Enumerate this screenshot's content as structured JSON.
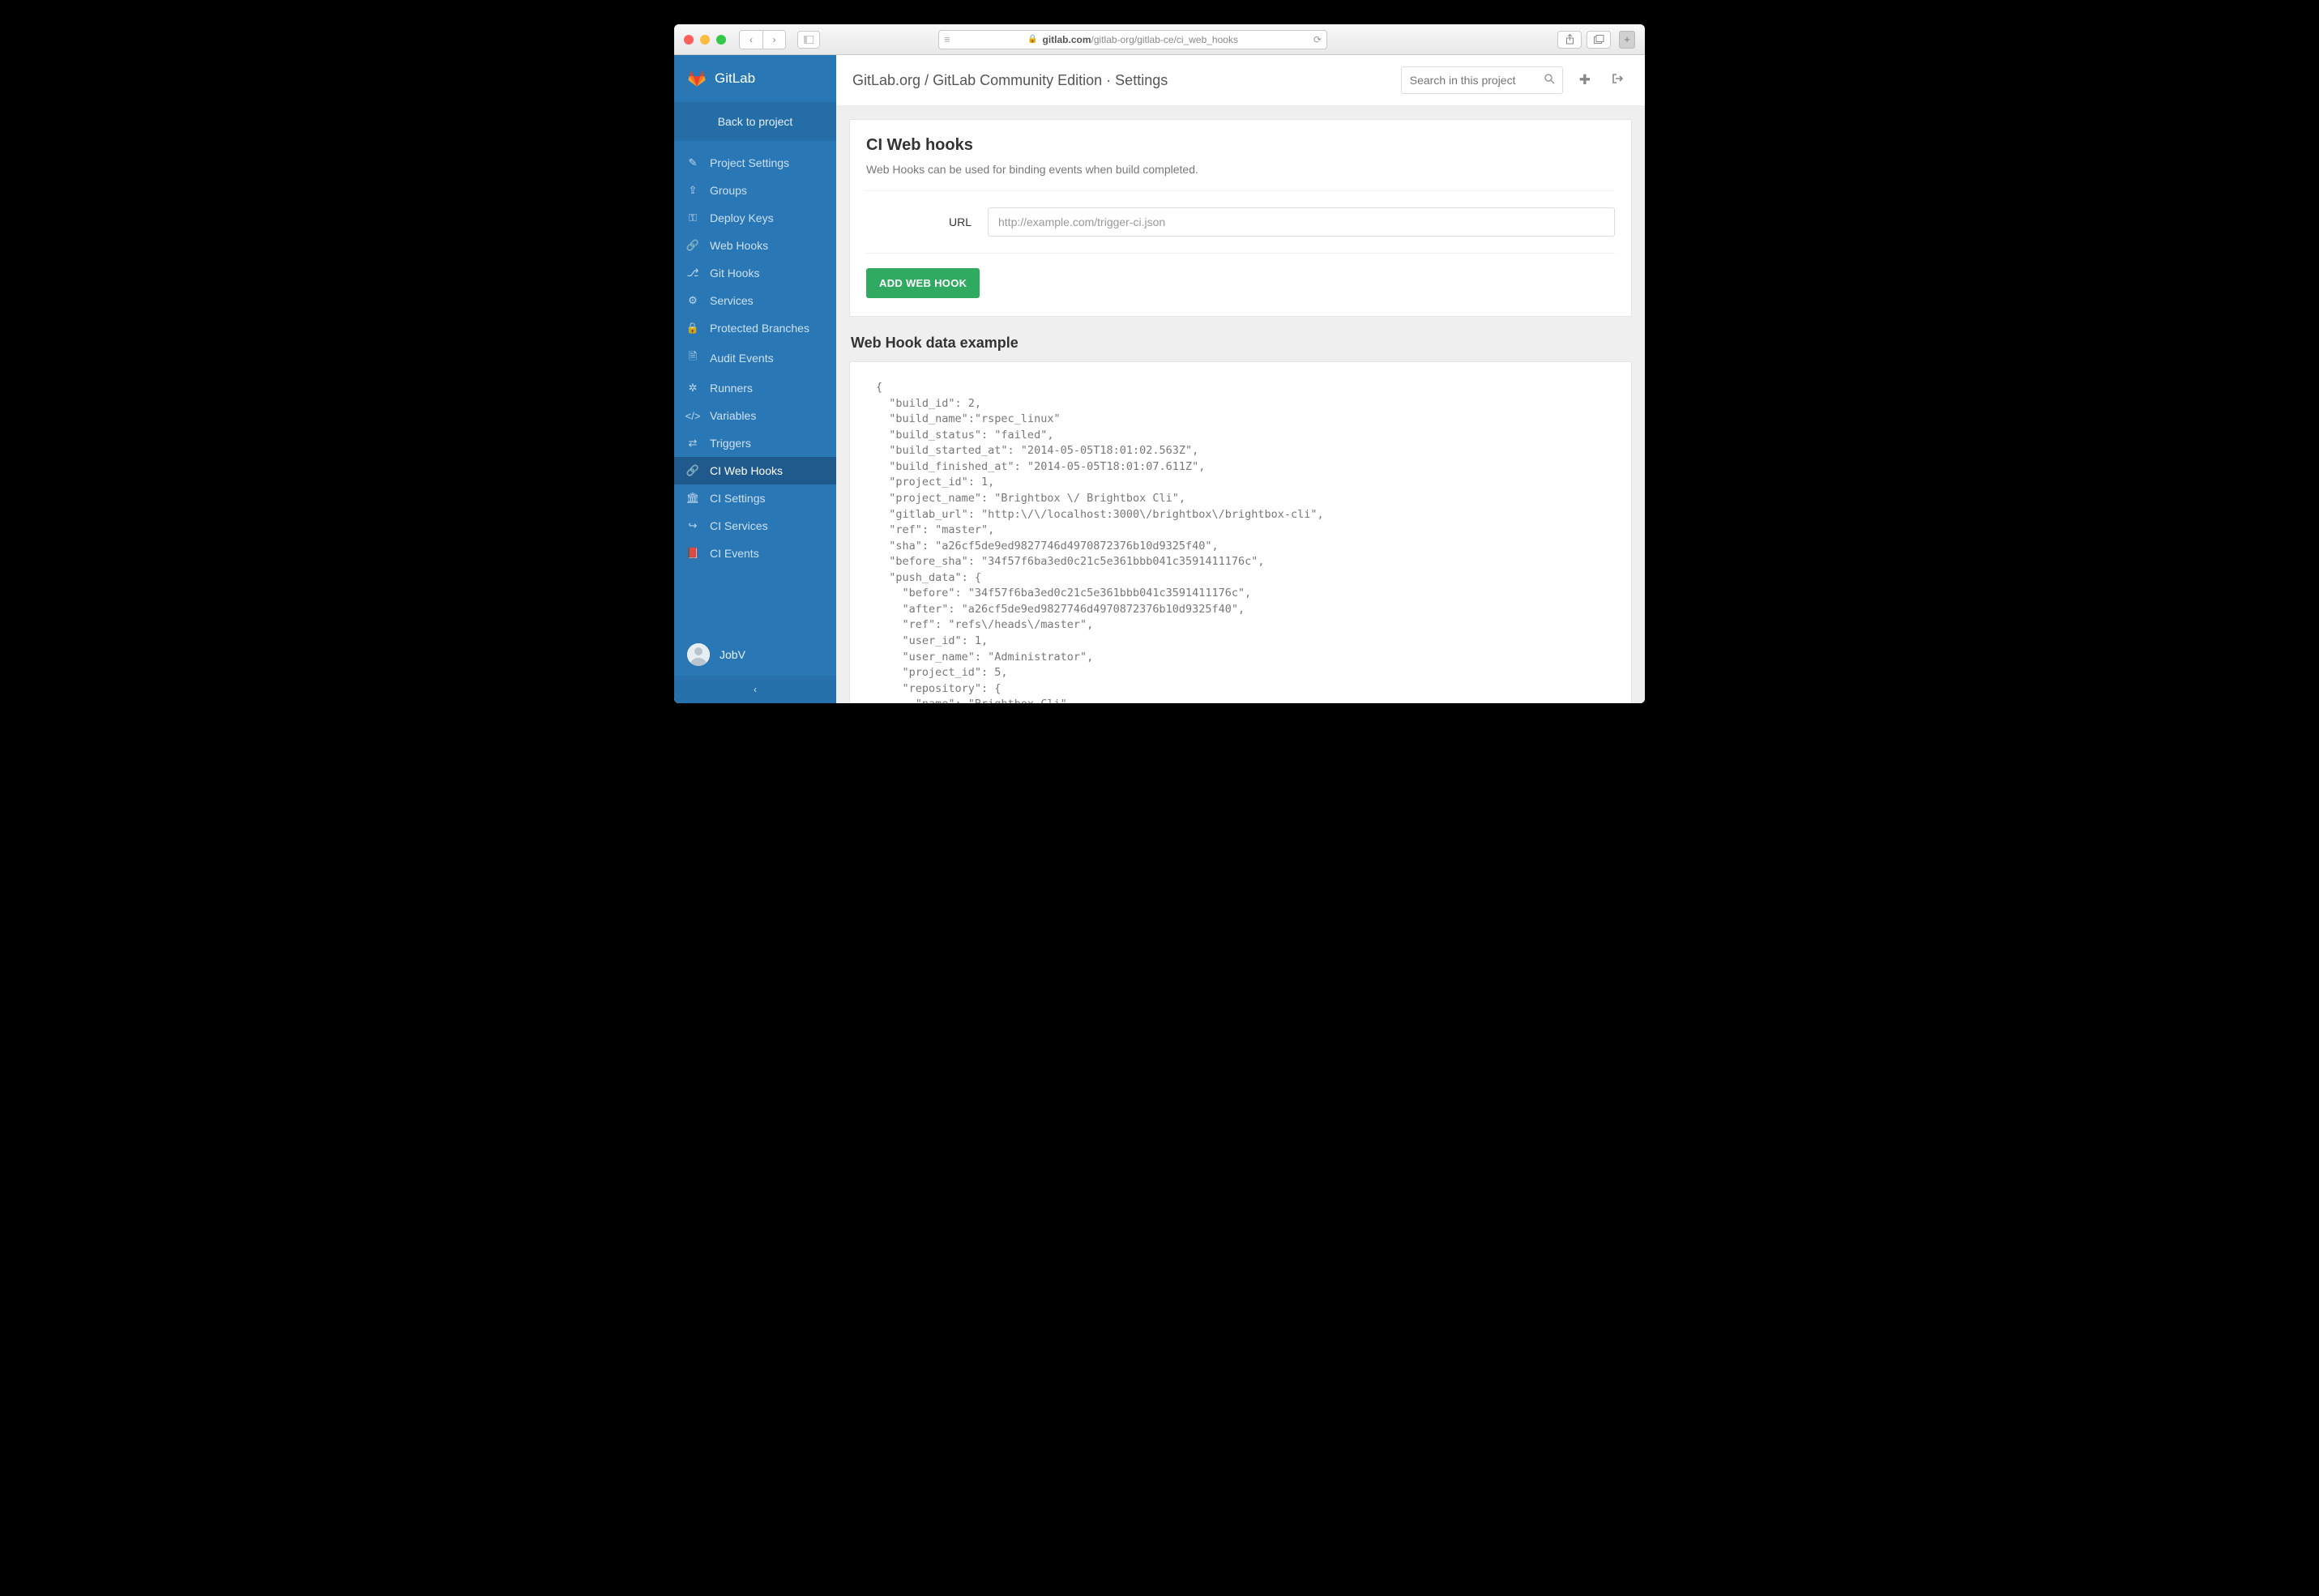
{
  "browser": {
    "url_display": "gitlab.com/gitlab-org/gitlab-ce/ci_web_hooks",
    "domain": "gitlab.com"
  },
  "brand": "GitLab",
  "sidebar": {
    "back_label": "Back to project",
    "items": [
      {
        "icon": "edit",
        "label": "Project Settings"
      },
      {
        "icon": "group",
        "label": "Groups"
      },
      {
        "icon": "key",
        "label": "Deploy Keys"
      },
      {
        "icon": "link",
        "label": "Web Hooks"
      },
      {
        "icon": "git",
        "label": "Git Hooks"
      },
      {
        "icon": "cogs",
        "label": "Services"
      },
      {
        "icon": "lock",
        "label": "Protected Branches"
      },
      {
        "icon": "file",
        "label": "Audit Events"
      },
      {
        "icon": "cog",
        "label": "Runners"
      },
      {
        "icon": "code",
        "label": "Variables"
      },
      {
        "icon": "retweet",
        "label": "Triggers"
      },
      {
        "icon": "link",
        "label": "CI Web Hooks",
        "active": true
      },
      {
        "icon": "building",
        "label": "CI Settings"
      },
      {
        "icon": "share",
        "label": "CI Services"
      },
      {
        "icon": "book",
        "label": "CI Events"
      }
    ]
  },
  "user": {
    "name": "JobV"
  },
  "breadcrumb": {
    "org": "GitLab.org",
    "project": "GitLab Community Edition",
    "section": "Settings"
  },
  "search": {
    "placeholder": "Search in this project"
  },
  "page": {
    "title": "CI Web hooks",
    "description": "Web Hooks can be used for binding events when build completed.",
    "url_label": "URL",
    "url_placeholder": "http://example.com/trigger-ci.json",
    "submit_label": "ADD WEB HOOK",
    "example_title": "Web Hook data example",
    "code": "{\n  \"build_id\": 2,\n  \"build_name\":\"rspec_linux\"\n  \"build_status\": \"failed\",\n  \"build_started_at\": \"2014-05-05T18:01:02.563Z\",\n  \"build_finished_at\": \"2014-05-05T18:01:07.611Z\",\n  \"project_id\": 1,\n  \"project_name\": \"Brightbox \\/ Brightbox Cli\",\n  \"gitlab_url\": \"http:\\/\\/localhost:3000\\/brightbox\\/brightbox-cli\",\n  \"ref\": \"master\",\n  \"sha\": \"a26cf5de9ed9827746d4970872376b10d9325f40\",\n  \"before_sha\": \"34f57f6ba3ed0c21c5e361bbb041c3591411176c\",\n  \"push_data\": {\n    \"before\": \"34f57f6ba3ed0c21c5e361bbb041c3591411176c\",\n    \"after\": \"a26cf5de9ed9827746d4970872376b10d9325f40\",\n    \"ref\": \"refs\\/heads\\/master\",\n    \"user_id\": 1,\n    \"user_name\": \"Administrator\",\n    \"project_id\": 5,\n    \"repository\": {\n      \"name\": \"Brightbox Cli\","
  },
  "icon_glyphs": {
    "edit": "✎",
    "group": "⇪",
    "key": "⚿",
    "link": "🔗",
    "git": "⎇",
    "cogs": "⚙",
    "lock": "🔒",
    "file": "🗎",
    "cog": "✲",
    "code": "</>",
    "retweet": "⇄",
    "building": "🏛",
    "share": "↪",
    "book": "📕"
  }
}
